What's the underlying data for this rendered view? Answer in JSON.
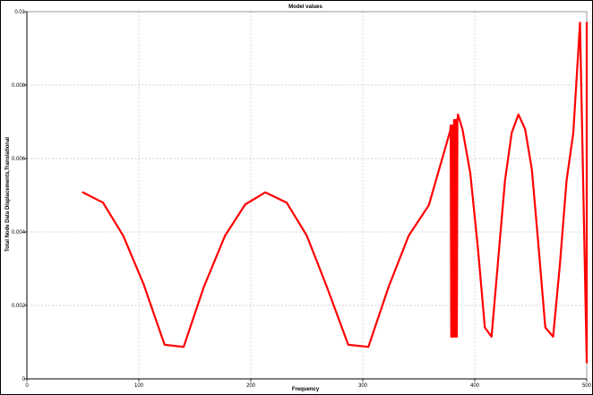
{
  "chart_data": {
    "type": "line",
    "title": "Model values",
    "xlabel": "Frequency",
    "ylabel": "Total Node Data Displacements,Translational",
    "xlim": [
      0,
      500
    ],
    "ylim": [
      0,
      0.01
    ],
    "x_ticks": [
      "0",
      "100",
      "200",
      "300",
      "400",
      "500"
    ],
    "y_ticks": [
      "0",
      "0.002",
      "0.004",
      "0.006",
      "0.008",
      "0.01"
    ],
    "grid": true,
    "colors": {
      "series": "#ff0000",
      "grid": "#c8c8c8",
      "axis": "#000000"
    },
    "series": [
      {
        "name": "",
        "x": [
          50,
          68,
          86,
          104,
          123,
          140,
          158,
          177,
          195,
          213,
          232,
          250,
          268,
          287,
          305,
          323,
          341,
          359,
          378,
          378.5,
          379,
          379.5,
          380,
          380.5,
          381,
          381.5,
          382,
          382.5,
          383,
          383.5,
          384,
          384.5,
          385,
          389,
          396,
          403,
          409,
          415,
          427,
          433,
          439,
          445,
          451,
          457,
          463,
          470,
          476,
          482,
          488,
          494,
          500,
          500
        ],
        "y": [
          0.00508,
          0.0048,
          0.0039,
          0.0026,
          0.00093,
          0.00087,
          0.0025,
          0.0039,
          0.00475,
          0.00508,
          0.0048,
          0.0039,
          0.0025,
          0.00093,
          0.00087,
          0.0025,
          0.0039,
          0.00473,
          0.00675,
          0.0069,
          0.00115,
          0.0069,
          0.00115,
          0.0069,
          0.00115,
          0.00705,
          0.00115,
          0.00705,
          0.00115,
          0.00705,
          0.00115,
          0.00705,
          0.0072,
          0.0068,
          0.0056,
          0.0035,
          0.0014,
          0.00115,
          0.0054,
          0.0067,
          0.0072,
          0.0068,
          0.0057,
          0.0036,
          0.0014,
          0.00115,
          0.0031,
          0.0054,
          0.0067,
          0.0097,
          0.00045,
          0.0097
        ]
      }
    ]
  }
}
